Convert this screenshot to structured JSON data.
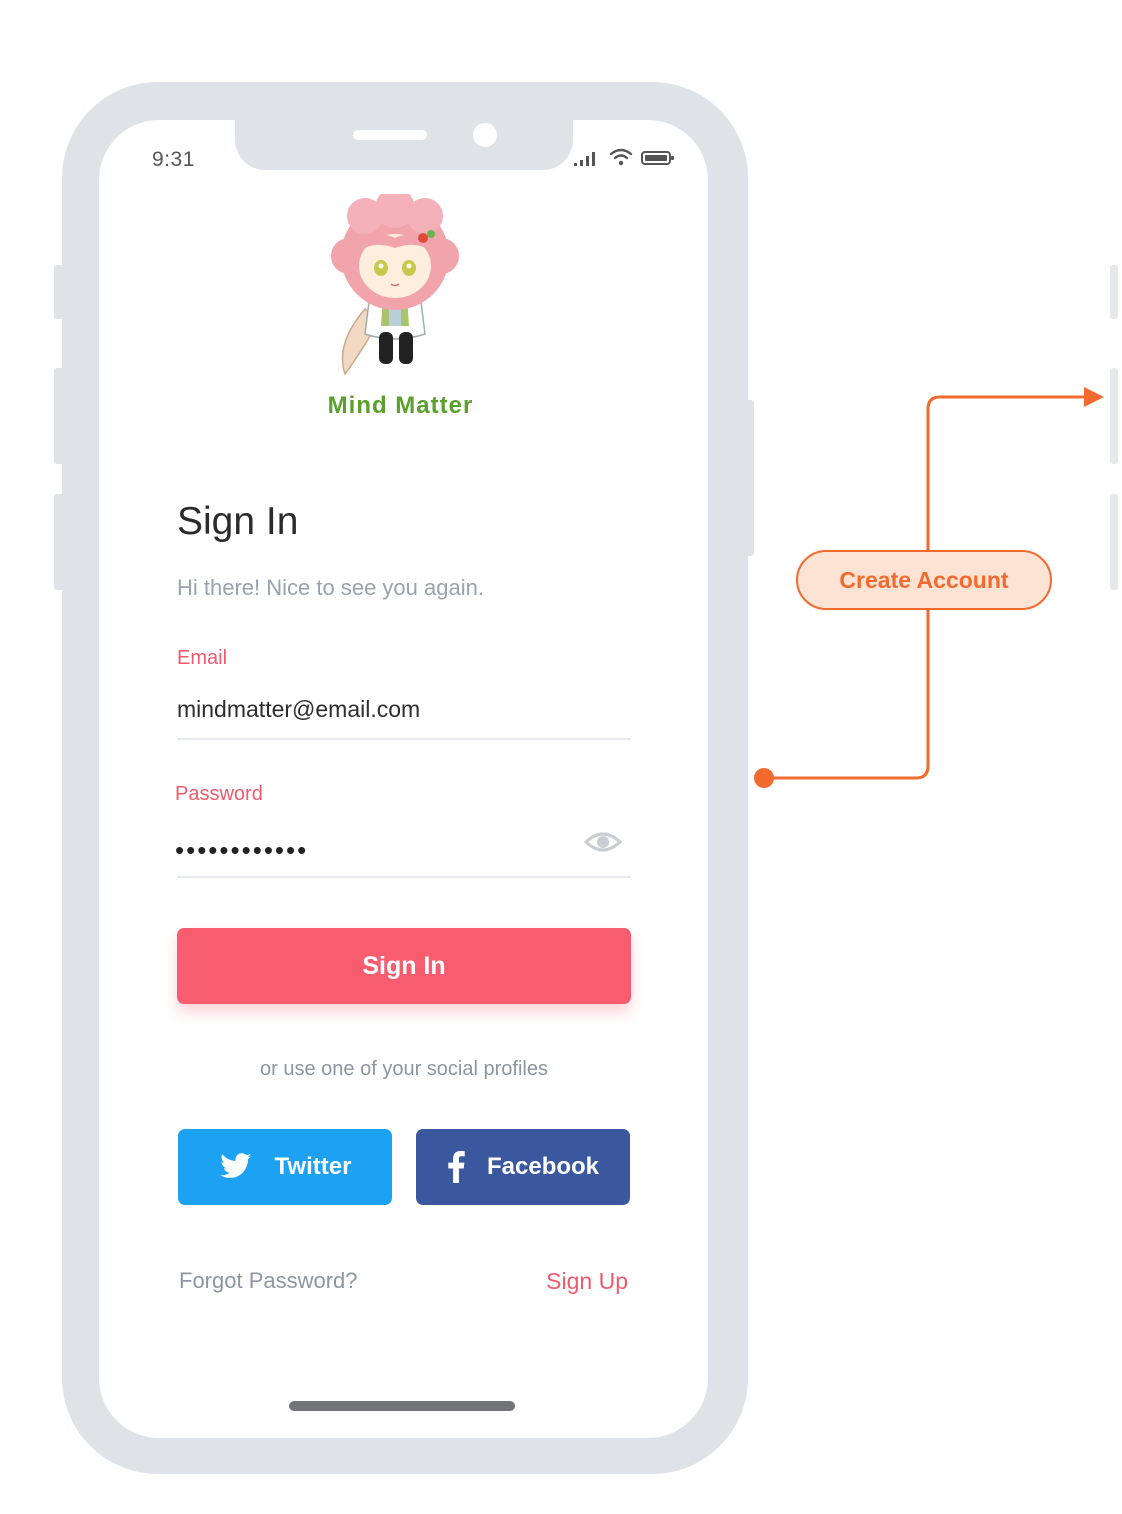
{
  "status_bar": {
    "time": "9:31"
  },
  "app": {
    "name": "Mind Matter"
  },
  "signin": {
    "title": "Sign In",
    "subtitle": "Hi there! Nice to see you again.",
    "email_label": "Email",
    "email_value": "mindmatter@email.com",
    "password_label": "Password",
    "password_value": "••••••••••••",
    "button_label": "Sign In",
    "social_prompt": "or use one of your social profiles"
  },
  "social": {
    "twitter_label": "Twitter",
    "facebook_label": "Facebook"
  },
  "footer": {
    "forgot_password": "Forgot Password?",
    "sign_up": "Sign Up"
  },
  "flow": {
    "create_account_label": "Create Account"
  },
  "colors": {
    "accent": "#f75d6f",
    "brand_green": "#5aa02c",
    "twitter": "#1da1f2",
    "facebook": "#3b579d",
    "flow_orange": "#f26a2e",
    "flow_fill": "#fde3d4",
    "frame_gray": "#dfe2e7"
  },
  "icons": {
    "signal": "signal-icon",
    "wifi": "wifi-icon",
    "battery": "battery-icon",
    "eye": "eye-icon",
    "twitter": "twitter-bird-icon",
    "facebook": "facebook-f-icon"
  }
}
